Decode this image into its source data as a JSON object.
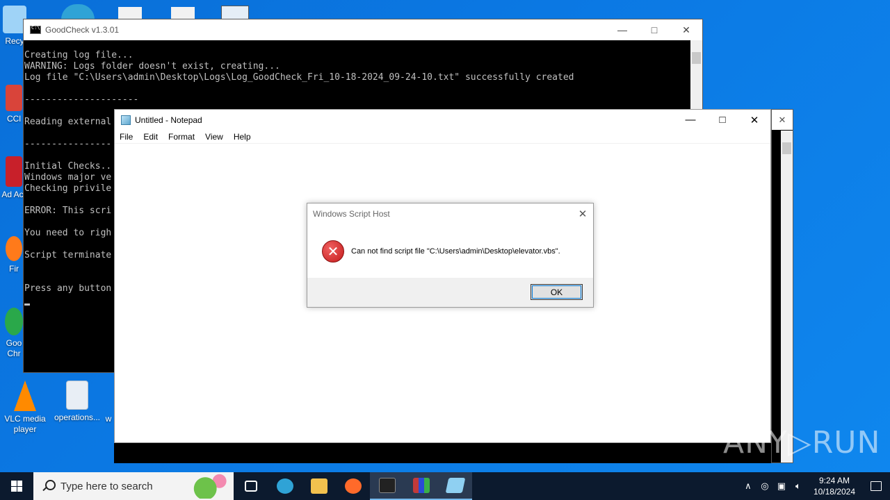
{
  "desktop": {
    "icons": [
      {
        "label": "Recy",
        "color": "#9fd3f7"
      },
      {
        "label": "CCl",
        "color": "#d9443a"
      },
      {
        "label": "Ad Acr",
        "color": "#c8202a"
      },
      {
        "label": "Fir",
        "color": "#ff7a1a"
      },
      {
        "label": "Goo Chr",
        "color": "#2aa84a"
      },
      {
        "label": "VLC media player",
        "color": "#ff8a00"
      },
      {
        "label": "operations...",
        "color": "#e8eef5"
      },
      {
        "label": "w",
        "color": "#e8eef5"
      }
    ]
  },
  "console": {
    "title": "GoodCheck v1.3.01",
    "lines": [
      "Creating log file...",
      "WARNING: Logs folder doesn't exist, creating...",
      "Log file \"C:\\Users\\admin\\Desktop\\Logs\\Log_GoodCheck_Fri_10-18-2024_09-24-10.txt\" successfully created",
      "",
      "---------------------",
      "",
      "Reading external",
      "",
      "----------------",
      "",
      "Initial Checks..",
      "Windows major ve",
      "Checking privile",
      "",
      "ERROR: This scri",
      "",
      "You need to righ",
      "",
      "Script terminate",
      "",
      "",
      "Press any button"
    ]
  },
  "notepad": {
    "title": "Untitled - Notepad",
    "menu": [
      "File",
      "Edit",
      "Format",
      "View",
      "Help"
    ]
  },
  "dialog": {
    "title": "Windows Script Host",
    "message": "Can not find script file \"C:\\Users\\admin\\Desktop\\elevator.vbs\".",
    "ok_label": "OK",
    "icon": "error-icon"
  },
  "watermark": "ANY▷RUN",
  "taskbar": {
    "search_placeholder": "Type here to search",
    "apps": [
      {
        "name": "task-view",
        "color": "#ffffff"
      },
      {
        "name": "edge",
        "color": "#2fa3d6"
      },
      {
        "name": "file-explorer",
        "color": "#f2c14e"
      },
      {
        "name": "firefox",
        "color": "#ff6a2a"
      },
      {
        "name": "command-prompt",
        "color": "#222222"
      },
      {
        "name": "app-multicolor",
        "color": "#c23a3a"
      },
      {
        "name": "notepad",
        "color": "#8fd0f2"
      }
    ],
    "time": "9:24 AM",
    "date": "10/18/2024"
  }
}
